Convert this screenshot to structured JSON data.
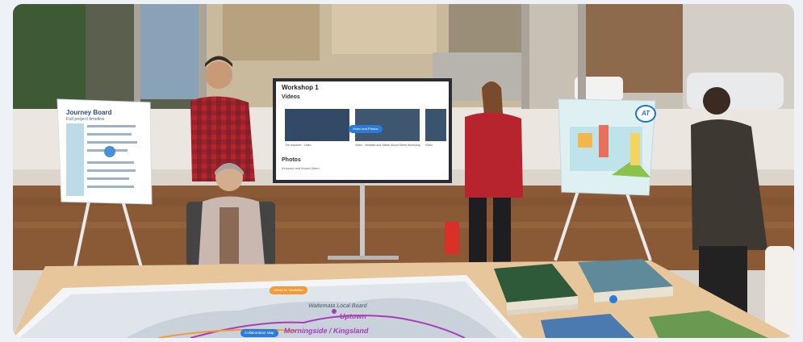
{
  "journey_board": {
    "title": "Journey Board",
    "subtitle": "Full project timeline"
  },
  "monitor": {
    "title": "Workshop 1",
    "videos_heading": "Videos",
    "video_chip": "Video and Photos",
    "video_captions": [
      "The launcher - Video",
      "Video - Ventilate and Waste Mount Street Workshop",
      "Video"
    ],
    "photos_heading": "Photos",
    "photos_sub": "Kinsland and Mount Albert"
  },
  "map": {
    "chip": "Ahead for Ventilation",
    "board_label": "Waitemata Local Board",
    "highlight_label": "Uptown",
    "route_label": "Morningside / Kingsland",
    "collab_button": "Collaboration Map"
  },
  "logo": {
    "text": "AT",
    "brand_color": "#1a73c7"
  },
  "colors": {
    "flannel_red": "#b8242e",
    "floor": "#8a5a36",
    "accent_blue": "#2d7bd8",
    "route_purple": "#a83db8"
  }
}
